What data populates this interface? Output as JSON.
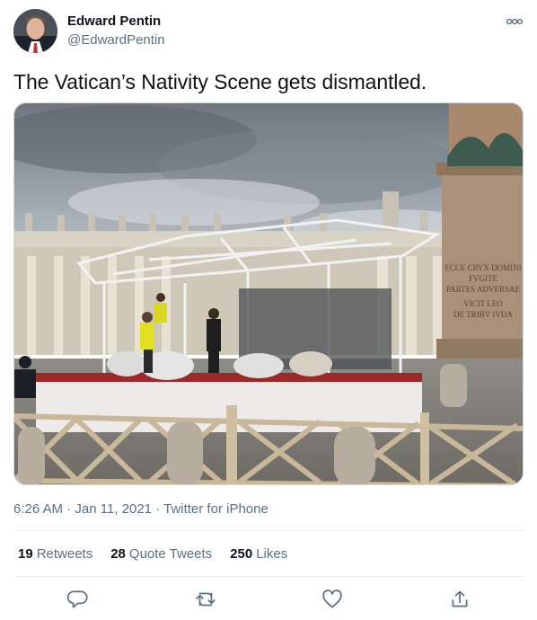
{
  "author": {
    "display_name": "Edward Pentin",
    "handle": "@EdwardPentin"
  },
  "tweet": {
    "text": "The Vatican’s Nativity Scene gets dismantled."
  },
  "photo": {
    "inscription": [
      "ECCE CRVX DOMINI",
      "FVGITE",
      "PARTES ADVERSAE",
      "VICIT LEO",
      "DE TRIBV IVDA"
    ]
  },
  "meta": {
    "time": "6:26 AM",
    "separator": " · ",
    "date": "Jan 11, 2021",
    "source": "Twitter for iPhone"
  },
  "stats": {
    "retweets_count": "19",
    "retweets_label": "Retweets",
    "quotes_count": "28",
    "quotes_label": "Quote Tweets",
    "likes_count": "250",
    "likes_label": "Likes"
  },
  "icons": {
    "more": "more-icon",
    "reply": "reply-icon",
    "retweet": "retweet-icon",
    "like": "like-icon",
    "share": "share-icon"
  },
  "colors": {
    "text": "#0f1419",
    "secondary": "#5b7083",
    "border": "#e6ecf0"
  }
}
